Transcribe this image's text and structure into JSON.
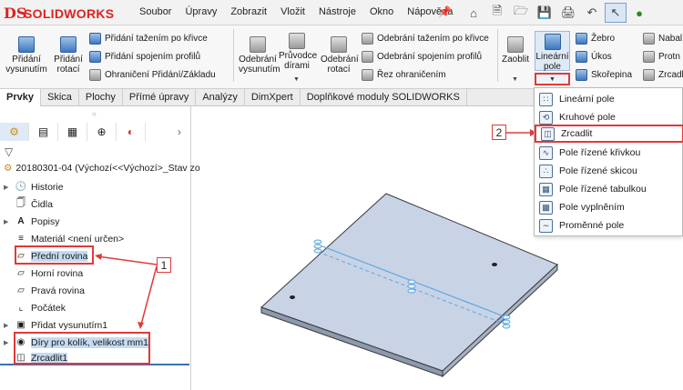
{
  "app": {
    "logo_text": "SOLIDWORKS",
    "logo_mark": "DS"
  },
  "menu": [
    "Soubor",
    "Úpravy",
    "Zobrazit",
    "Vložit",
    "Nástroje",
    "Okno",
    "Nápověda"
  ],
  "ribbon": {
    "pridani_vysunutim": "Přidání vysunutím",
    "pridani_rotaci": "Přidání rotací",
    "pridani_tazenim": "Přidání tažením po křivce",
    "pridani_spojenim": "Přidání spojením profilů",
    "ohraniceni_pridani": "Ohraničení Přidání/Základu",
    "odebrani_vysunutim": "Odebrání vysunutím",
    "pruvodce_dirami": "Průvodce dírami",
    "odebrani_rotaci": "Odebrání rotací",
    "odebrani_tazenim": "Odebrání tažením po křivce",
    "odebrani_spojenim": "Odebrání spojením profilů",
    "rez_ohranicenim": "Řez ohraničením",
    "zaoblit": "Zaoblit",
    "linearni_pole": "Lineární pole",
    "zebro": "Žebro",
    "ukos": "Úkos",
    "skorepina": "Skořepina",
    "nabal": "Nabal",
    "protn": "Protn",
    "zrcadl": "Zrcadl"
  },
  "tabs": [
    "Prvky",
    "Skica",
    "Plochy",
    "Přímé úpravy",
    "Analýzy",
    "DimXpert",
    "Doplňkové moduly SOLIDWORKS"
  ],
  "tree": {
    "root": "20180301-04  (Výchozí<<Výchozí>_Stav zo",
    "items": [
      {
        "label": "Historie"
      },
      {
        "label": "Čidla"
      },
      {
        "label": "Popisy"
      },
      {
        "label": "Materiál <není určen>"
      },
      {
        "label": "Přední rovina"
      },
      {
        "label": "Horní rovina"
      },
      {
        "label": "Pravá rovina"
      },
      {
        "label": "Počátek"
      },
      {
        "label": "Přidat vysunutím1"
      },
      {
        "label": "Díry pro kolík, velikost mm1"
      },
      {
        "label": "Zrcadlit1"
      }
    ]
  },
  "dropdown": {
    "items": [
      {
        "label": "Lineární pole"
      },
      {
        "label": "Kruhové pole"
      },
      {
        "label": "Zrcadlit"
      },
      {
        "label": "Pole řízené křivkou"
      },
      {
        "label": "Pole řízené skicou"
      },
      {
        "label": "Pole řízené tabulkou"
      },
      {
        "label": "Pole vyplněním"
      },
      {
        "label": "Proměnné pole"
      }
    ]
  },
  "callouts": {
    "one": "1",
    "two": "2"
  },
  "colors": {
    "annotation_red": "#e03a3a",
    "plate_face": "#c9d3e6",
    "plane_line": "#5aa8e0"
  }
}
